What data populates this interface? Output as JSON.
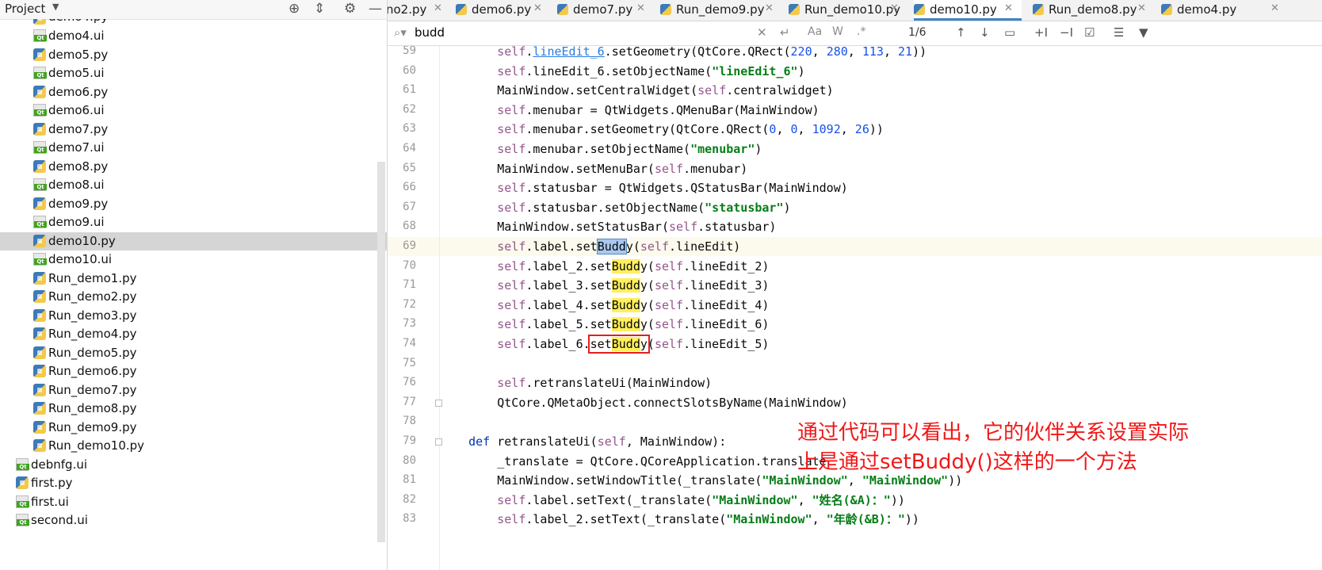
{
  "project_panel": {
    "title": "Project",
    "icons": [
      "locate-icon",
      "collapse-icon",
      "gear-icon",
      "minimize-icon"
    ],
    "items": [
      {
        "label": "demo4.py",
        "type": "py",
        "indent": 1,
        "partial": true
      },
      {
        "label": "demo4.ui",
        "type": "ui",
        "indent": 1
      },
      {
        "label": "demo5.py",
        "type": "py",
        "indent": 1
      },
      {
        "label": "demo5.ui",
        "type": "ui",
        "indent": 1
      },
      {
        "label": "demo6.py",
        "type": "py",
        "indent": 1
      },
      {
        "label": "demo6.ui",
        "type": "ui",
        "indent": 1
      },
      {
        "label": "demo7.py",
        "type": "py",
        "indent": 1
      },
      {
        "label": "demo7.ui",
        "type": "ui",
        "indent": 1
      },
      {
        "label": "demo8.py",
        "type": "py",
        "indent": 1
      },
      {
        "label": "demo8.ui",
        "type": "ui",
        "indent": 1
      },
      {
        "label": "demo9.py",
        "type": "py",
        "indent": 1
      },
      {
        "label": "demo9.ui",
        "type": "ui",
        "indent": 1
      },
      {
        "label": "demo10.py",
        "type": "py",
        "indent": 1,
        "selected": true
      },
      {
        "label": "demo10.ui",
        "type": "ui",
        "indent": 1
      },
      {
        "label": "Run_demo1.py",
        "type": "py",
        "indent": 1
      },
      {
        "label": "Run_demo2.py",
        "type": "py",
        "indent": 1
      },
      {
        "label": "Run_demo3.py",
        "type": "py",
        "indent": 1
      },
      {
        "label": "Run_demo4.py",
        "type": "py",
        "indent": 1
      },
      {
        "label": "Run_demo5.py",
        "type": "py",
        "indent": 1
      },
      {
        "label": "Run_demo6.py",
        "type": "py",
        "indent": 1
      },
      {
        "label": "Run_demo7.py",
        "type": "py",
        "indent": 1
      },
      {
        "label": "Run_demo8.py",
        "type": "py",
        "indent": 1
      },
      {
        "label": "Run_demo9.py",
        "type": "py",
        "indent": 1
      },
      {
        "label": "Run_demo10.py",
        "type": "py",
        "indent": 1
      },
      {
        "label": "debnfg.ui",
        "type": "ui",
        "indent": 0
      },
      {
        "label": "first.py",
        "type": "py",
        "indent": 0
      },
      {
        "label": "first.ui",
        "type": "ui",
        "indent": 0
      },
      {
        "label": "second.ui",
        "type": "ui",
        "indent": 0
      }
    ]
  },
  "tabs": [
    {
      "label": "no2.py",
      "active": false,
      "partial": true
    },
    {
      "label": "demo6.py",
      "active": false
    },
    {
      "label": "demo7.py",
      "active": false
    },
    {
      "label": "Run_demo9.py",
      "active": false
    },
    {
      "label": "Run_demo10.py",
      "active": false
    },
    {
      "label": "demo10.py",
      "active": true
    },
    {
      "label": "Run_demo8.py",
      "active": false
    },
    {
      "label": "demo4.py",
      "active": false
    }
  ],
  "search": {
    "query": "budd",
    "match_count": "1/6",
    "options": [
      "Aa",
      "W",
      ".*"
    ]
  },
  "code": {
    "lines": [
      {
        "n": "59",
        "html": "        <span class=\"self\">self</span>.<span class=\"link\">lineEdit_6</span>.setGeometry(QtCore.QRect(<span class=\"num\">220</span>, <span class=\"num\">280</span>, <span class=\"num\">113</span>, <span class=\"num\">21</span>))"
      },
      {
        "n": "60",
        "html": "        <span class=\"self\">self</span>.lineEdit_6.setObjectName(<span class=\"str\">\"lineEdit_6\"</span>)"
      },
      {
        "n": "61",
        "html": "        MainWindow.setCentralWidget(<span class=\"self\">self</span>.centralwidget)"
      },
      {
        "n": "62",
        "html": "        <span class=\"self\">self</span>.menubar = QtWidgets.QMenuBar(MainWindow)"
      },
      {
        "n": "63",
        "html": "        <span class=\"self\">self</span>.menubar.setGeometry(QtCore.QRect(<span class=\"num\">0</span>, <span class=\"num\">0</span>, <span class=\"num\">1092</span>, <span class=\"num\">26</span>))"
      },
      {
        "n": "64",
        "html": "        <span class=\"self\">self</span>.menubar.setObjectName(<span class=\"str\">\"menubar\"</span>)"
      },
      {
        "n": "65",
        "html": "        MainWindow.setMenuBar(<span class=\"self\">self</span>.menubar)"
      },
      {
        "n": "66",
        "html": "        <span class=\"self\">self</span>.statusbar = QtWidgets.QStatusBar(MainWindow)"
      },
      {
        "n": "67",
        "html": "        <span class=\"self\">self</span>.statusbar.setObjectName(<span class=\"str\">\"statusbar\"</span>)"
      },
      {
        "n": "68",
        "html": "        MainWindow.setStatusBar(<span class=\"self\">self</span>.statusbar)"
      },
      {
        "n": "69",
        "html": "        <span class=\"self\">self</span>.label.set<span class=\"hl-cur\">Budd</span>y(<span class=\"self\">self</span>.lineEdit)",
        "current": true
      },
      {
        "n": "70",
        "html": "        <span class=\"self\">self</span>.label_2.set<span class=\"hl\">Budd</span>y(<span class=\"self\">self</span>.lineEdit_2)"
      },
      {
        "n": "71",
        "html": "        <span class=\"self\">self</span>.label_3.set<span class=\"hl\">Budd</span>y(<span class=\"self\">self</span>.lineEdit_3)"
      },
      {
        "n": "72",
        "html": "        <span class=\"self\">self</span>.label_4.set<span class=\"hl\">Budd</span>y(<span class=\"self\">self</span>.lineEdit_4)"
      },
      {
        "n": "73",
        "html": "        <span class=\"self\">self</span>.label_5.set<span class=\"hl\">Budd</span>y(<span class=\"self\">self</span>.lineEdit_6)"
      },
      {
        "n": "74",
        "html": "        <span class=\"self\">self</span>.label_6.<span class=\"redbox\">set<span class=\"hl\">Budd</span>y</span>(<span class=\"self\">self</span>.lineEdit_5)"
      },
      {
        "n": "75",
        "html": ""
      },
      {
        "n": "76",
        "html": "        <span class=\"self\">self</span>.retranslateUi(MainWindow)"
      },
      {
        "n": "77",
        "html": "        QtCore.QMetaObject.connectSlotsByName(MainWindow)",
        "fold": true
      },
      {
        "n": "78",
        "html": ""
      },
      {
        "n": "79",
        "html": "    <span class=\"kw\">def</span> retranslateUi(<span class=\"self\">self</span>, MainWindow):",
        "fold": true
      },
      {
        "n": "80",
        "html": "        _translate = QtCore.QCoreApplication.translate"
      },
      {
        "n": "81",
        "html": "        MainWindow.setWindowTitle(_translate(<span class=\"str\">\"MainWindow\"</span>, <span class=\"str\">\"MainWindow\"</span>))"
      },
      {
        "n": "82",
        "html": "        <span class=\"self\">self</span>.label.setText(_translate(<span class=\"str\">\"MainWindow\"</span>, <span class=\"str\">\"姓名(&amp;A)：\"</span>))"
      },
      {
        "n": "83",
        "html": "        <span class=\"self\">self</span>.label_2.setText(_translate(<span class=\"str\">\"MainWindow\"</span>, <span class=\"str\">\"年龄(&amp;B)：\"</span>))"
      }
    ]
  },
  "annotation": {
    "line1": "通过代码可以看出，它的伙伴关系设置实际",
    "line2": "上是通过setBuddy()这样的一个方法",
    "color": "#f01818"
  },
  "colors": {
    "accent": "#4083c9",
    "match_highlight": "#ffef5c",
    "current_match": "#a8c8f0",
    "annotation_red": "#f01818"
  }
}
